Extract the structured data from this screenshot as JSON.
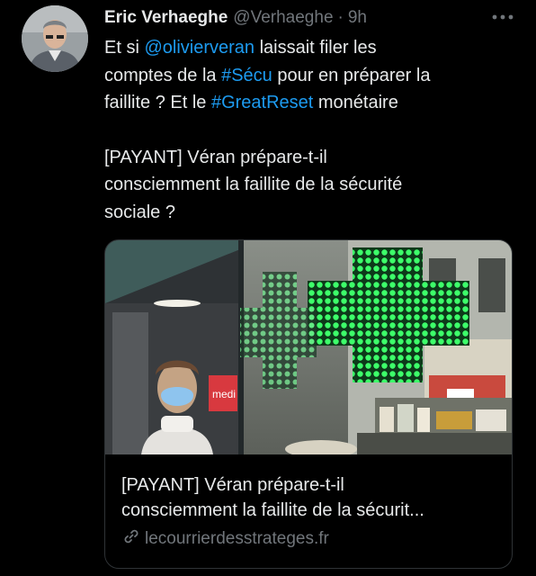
{
  "tweet": {
    "author_name": "Eric Verhaeghe",
    "handle": "@Verhaeghe",
    "separator": "·",
    "time": "9h",
    "more_icon": "more-icon",
    "line1": {
      "t1": "Et si ",
      "mention": "@olivierveran",
      "t2": " laissait filer les",
      "t3": "comptes de la ",
      "hashtag1": "#Sécu",
      "t4": " pour en préparer la",
      "t5": "faillite ? Et le ",
      "hashtag2": "#GreatReset",
      "t6": " monétaire"
    },
    "line2": {
      "a": "[PAYANT] Véran prépare-t-il",
      "b": "consciemment la faillite de la sécurité",
      "c": "sociale ?"
    }
  },
  "card": {
    "image_sign_text": "medi",
    "title_line1": "[PAYANT] Véran prépare-t-il",
    "title_line2": "consciemment la faillite de la sécurit...",
    "domain": "lecourrierdesstrateges.fr",
    "link_icon": "link-icon"
  },
  "colors": {
    "background": "#000000",
    "text": "#e7e9ea",
    "secondary": "#71767b",
    "link": "#1d9bf0",
    "border": "#2f3336",
    "pharmacy_green": "#2fe35a"
  }
}
